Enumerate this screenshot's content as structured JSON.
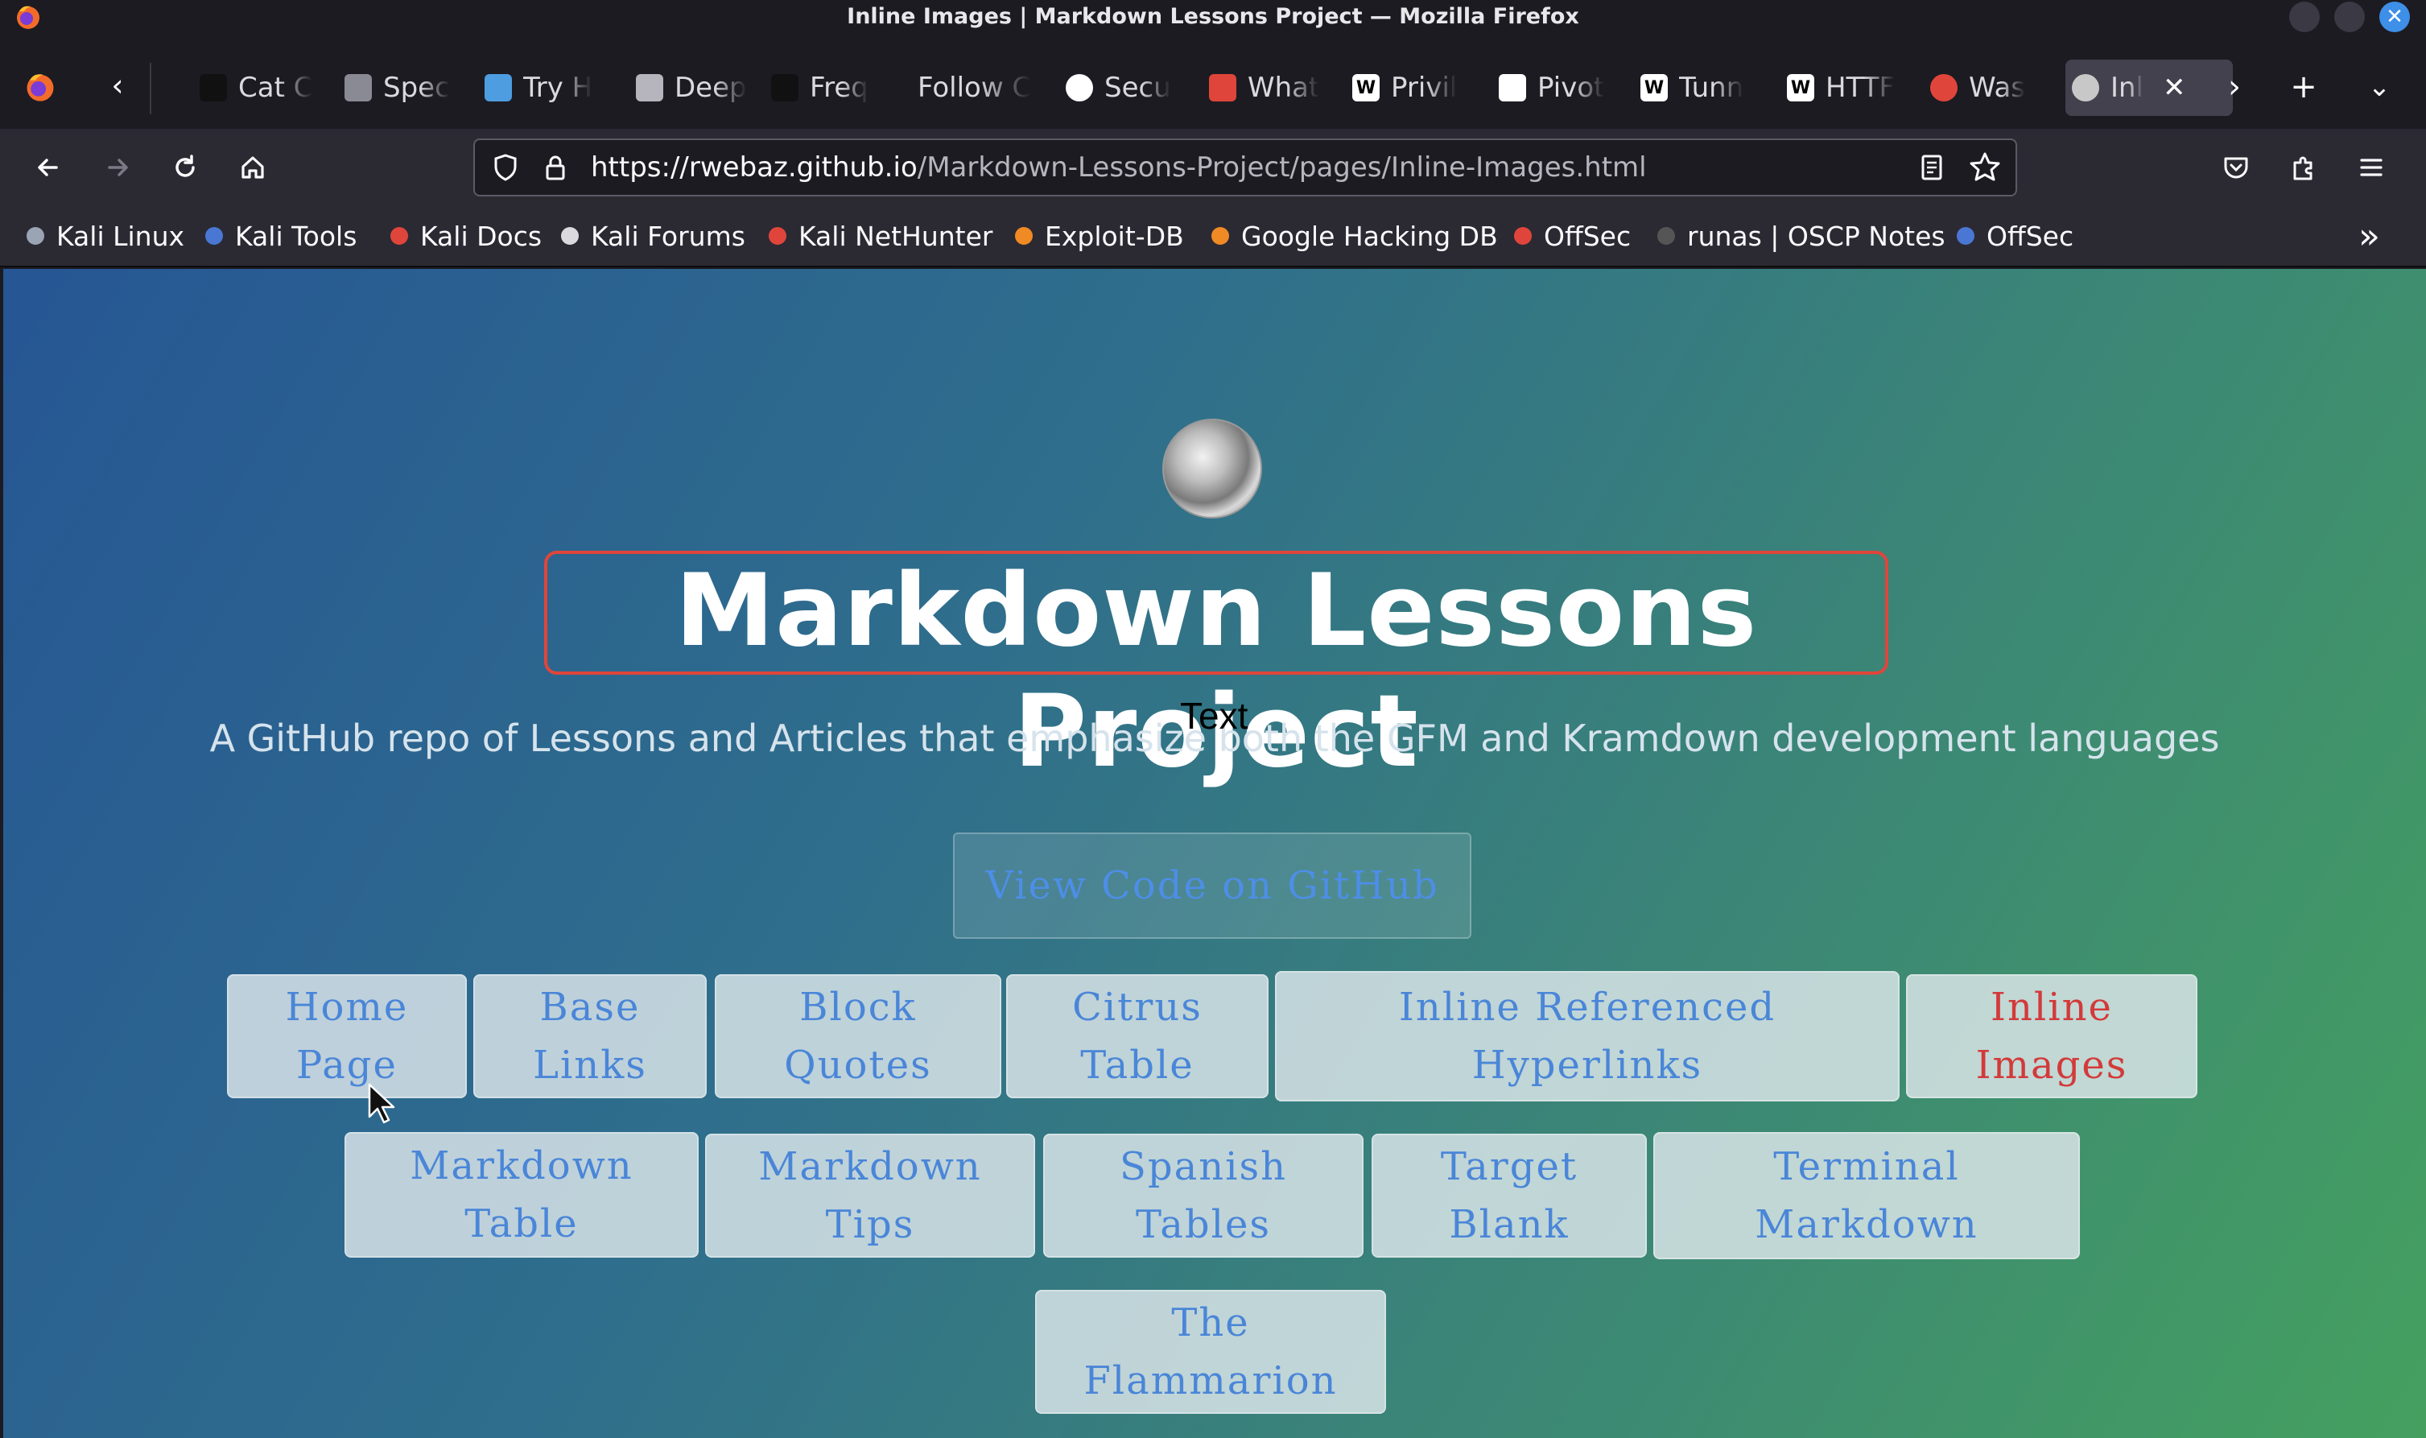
{
  "window": {
    "title": "Inline Images | Markdown Lessons Project — Mozilla Firefox",
    "close_glyph": "✕"
  },
  "tabs": [
    {
      "label": "Cat C",
      "icon": "hexagon-icon",
      "color": "#111111"
    },
    {
      "label": "Spec",
      "icon": "play-icon",
      "color": "#8a8a95"
    },
    {
      "label": "Try H",
      "icon": "tryhackme-icon",
      "color": "#4d9de0"
    },
    {
      "label": "Deep",
      "icon": "arrow-icon",
      "color": "#b6b5bd"
    },
    {
      "label": "Freq",
      "icon": "d-logo-icon",
      "color": "#111111"
    },
    {
      "label": "Follow C",
      "icon": "",
      "color": ""
    },
    {
      "label": "Secu",
      "icon": "compass-icon",
      "color": "#ffffff"
    },
    {
      "label": "What",
      "icon": "slash-icon",
      "color": "#e0453b"
    },
    {
      "label": "Privil",
      "icon": "wikipedia-icon",
      "color": "#ffffff"
    },
    {
      "label": "Pivot",
      "icon": "tool-icon",
      "color": "#ffffff"
    },
    {
      "label": "Tunn",
      "icon": "wikipedia-icon",
      "color": "#ffffff"
    },
    {
      "label": "HTTF",
      "icon": "wikipedia-icon",
      "color": "#ffffff"
    },
    {
      "label": "Was",
      "icon": "c-logo-icon",
      "color": "#e0453b"
    },
    {
      "label": "Inl",
      "icon": "globe-icon",
      "color": "#c8c8c8",
      "active": true
    }
  ],
  "toolbar": {
    "url_host": "https://rwebaz.github.io",
    "url_path": "/Markdown-Lessons-Project/pages/Inline-Images.html"
  },
  "bookmarks": [
    {
      "label": "Kali Linux",
      "icon": "kali-dragon-icon",
      "color": "#9aa4b5"
    },
    {
      "label": "Kali Tools",
      "icon": "kali-tools-icon",
      "color": "#4a77d4"
    },
    {
      "label": "Kali Docs",
      "icon": "kali-docs-icon",
      "color": "#e0453b"
    },
    {
      "label": "Kali Forums",
      "icon": "kali-forums-icon",
      "color": "#d9d9de"
    },
    {
      "label": "Kali NetHunter",
      "icon": "nethunter-icon",
      "color": "#e0453b"
    },
    {
      "label": "Exploit-DB",
      "icon": "exploitdb-icon",
      "color": "#f08a24"
    },
    {
      "label": "Google Hacking DB",
      "icon": "ghdb-icon",
      "color": "#f08a24"
    },
    {
      "label": "OffSec",
      "icon": "offsec-icon",
      "color": "#e0453b"
    },
    {
      "label": "runas | OSCP Notes",
      "icon": "runas-icon",
      "color": "#555555"
    },
    {
      "label": "OffSec",
      "icon": "offsec-icon-2",
      "color": "#4a77d4"
    }
  ],
  "page": {
    "title": "Markdown Lessons Project",
    "tooltip": "Text",
    "tagline": "A GitHub repo of Lessons and Articles that emphasize both the GFM and Kramdown development languages",
    "github_button": "View Code on GitHub",
    "nav_links": [
      {
        "line1": "Home",
        "line2": "Page"
      },
      {
        "line1": "Base",
        "line2": "Links"
      },
      {
        "line1": "Block",
        "line2": "Quotes"
      },
      {
        "line1": "Citrus",
        "line2": "Table"
      },
      {
        "line1": "Inline Referenced",
        "line2": "Hyperlinks"
      },
      {
        "line1": "Inline",
        "line2": "Images",
        "current": true
      },
      {
        "line1": "Markdown",
        "line2": "Table"
      },
      {
        "line1": "Markdown",
        "line2": "Tips"
      },
      {
        "line1": "Spanish",
        "line2": "Tables"
      },
      {
        "line1": "Target",
        "line2": "Blank"
      },
      {
        "line1": "Terminal",
        "line2": "Markdown"
      },
      {
        "line1": "The",
        "line2": "Flammarion"
      }
    ]
  }
}
